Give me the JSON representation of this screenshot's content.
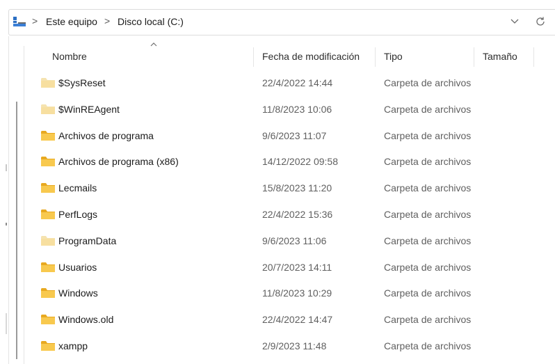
{
  "address_bar": {
    "breadcrumbs": [
      "Este equipo",
      "Disco local (C:)"
    ],
    "separator": ">",
    "dropdown_icon": "chevron-down-icon",
    "refresh_icon": "refresh-icon",
    "location_icon": "computer-icon"
  },
  "columns": {
    "name": "Nombre",
    "modified": "Fecha de modificación",
    "type": "Tipo",
    "size": "Tamaño",
    "sorted_by": "name"
  },
  "colors": {
    "folder_yellow": "#f8c94e",
    "folder_faded": "#f5deA0",
    "accent_blue": "#2b6fc4"
  },
  "rows": [
    {
      "name": "$SysReset",
      "modified": "22/4/2022 14:44",
      "type": "Carpeta de archivos",
      "size": "",
      "hidden": true
    },
    {
      "name": "$WinREAgent",
      "modified": "11/8/2023 10:06",
      "type": "Carpeta de archivos",
      "size": "",
      "hidden": true
    },
    {
      "name": "Archivos de programa",
      "modified": "9/6/2023 11:07",
      "type": "Carpeta de archivos",
      "size": "",
      "hidden": false
    },
    {
      "name": "Archivos de programa (x86)",
      "modified": "14/12/2022 09:58",
      "type": "Carpeta de archivos",
      "size": "",
      "hidden": false
    },
    {
      "name": "Lecmails",
      "modified": "15/8/2023 11:20",
      "type": "Carpeta de archivos",
      "size": "",
      "hidden": false
    },
    {
      "name": "PerfLogs",
      "modified": "22/4/2022 15:36",
      "type": "Carpeta de archivos",
      "size": "",
      "hidden": false
    },
    {
      "name": "ProgramData",
      "modified": "9/6/2023 11:06",
      "type": "Carpeta de archivos",
      "size": "",
      "hidden": true
    },
    {
      "name": "Usuarios",
      "modified": "20/7/2023 14:11",
      "type": "Carpeta de archivos",
      "size": "",
      "hidden": false
    },
    {
      "name": "Windows",
      "modified": "11/8/2023 10:29",
      "type": "Carpeta de archivos",
      "size": "",
      "hidden": false
    },
    {
      "name": "Windows.old",
      "modified": "22/4/2022 14:47",
      "type": "Carpeta de archivos",
      "size": "",
      "hidden": false
    },
    {
      "name": "xampp",
      "modified": "2/9/2023 11:48",
      "type": "Carpeta de archivos",
      "size": "",
      "hidden": false
    }
  ]
}
